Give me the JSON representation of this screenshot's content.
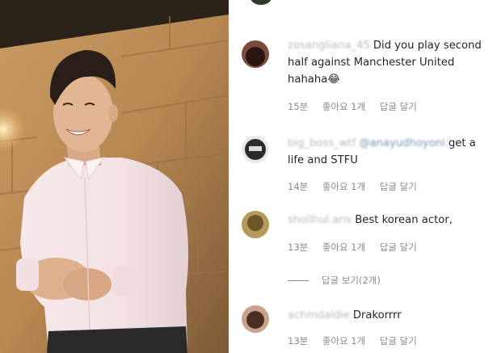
{
  "photo": {
    "description_icon": "person-photo"
  },
  "comments": [
    {
      "username": "zosangliana_45",
      "mention": "",
      "text": "Did you play second half against Manchester United hahaha😂",
      "time": "15분",
      "likes": "좋아요 1개",
      "reply": "답글 달기",
      "avatar_color": "#3a2420"
    },
    {
      "username": "big_boss_wtf",
      "mention": "@anayudhoyoni",
      "text": "get a life and STFU",
      "time": "14분",
      "likes": "좋아요 1개",
      "reply": "답글 달기",
      "avatar_color": "#2c2c2c"
    },
    {
      "username": "shollhul.aris",
      "mention": "",
      "text": "Best korean actor,",
      "time": "13분",
      "likes": "좋아요 1개",
      "reply": "답글 달기",
      "avatar_color": "#8a7440",
      "view_replies": "답글 보기(2개)"
    },
    {
      "username": "achmdaldie",
      "mention": "",
      "text": "Drakorrrr",
      "time": "13분",
      "likes": "좋아요 1개",
      "reply": "답글 달기",
      "avatar_color": "#6b4a3a"
    }
  ]
}
